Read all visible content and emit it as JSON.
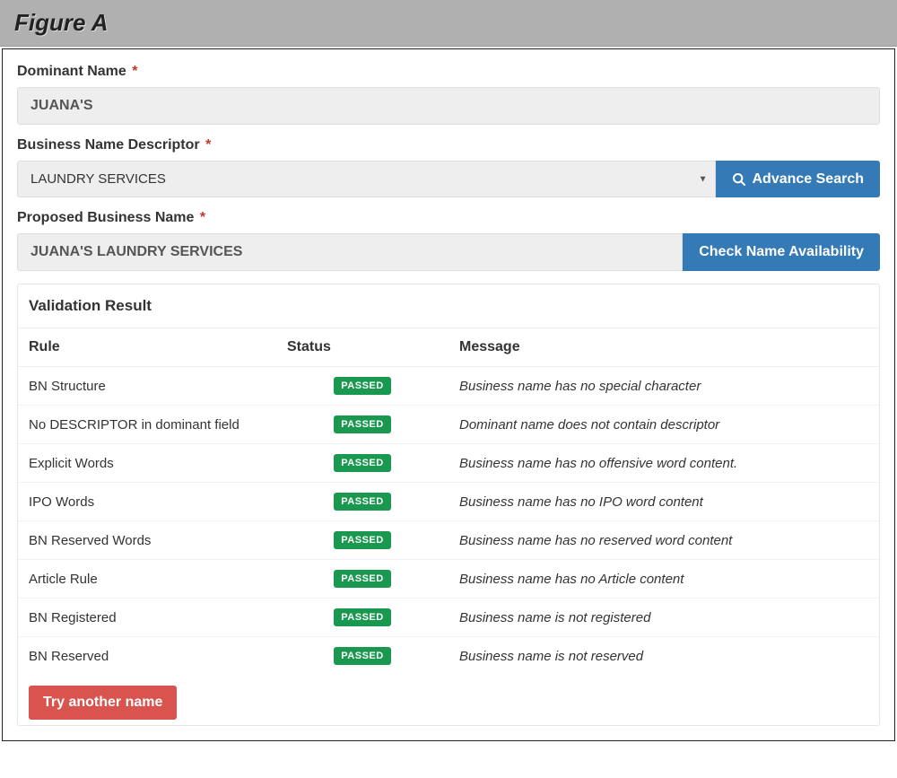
{
  "figure_title": "Figure A",
  "labels": {
    "dominant_name": "Dominant Name",
    "descriptor": "Business Name Descriptor",
    "proposed": "Proposed Business Name",
    "required_mark": "*"
  },
  "fields": {
    "dominant_value": "JUANA'S",
    "descriptor_value": "LAUNDRY SERVICES",
    "proposed_value": "JUANA'S LAUNDRY SERVICES"
  },
  "buttons": {
    "advance_search": "Advance Search",
    "check_availability": "Check Name Availability",
    "try_another": "Try another name"
  },
  "validation": {
    "title": "Validation Result",
    "columns": {
      "rule": "Rule",
      "status": "Status",
      "message": "Message"
    },
    "passed_label": "PASSED",
    "rows": [
      {
        "rule": "BN Structure",
        "status": "PASSED",
        "message": "Business name has no special character"
      },
      {
        "rule": "No DESCRIPTOR in dominant field",
        "status": "PASSED",
        "message": "Dominant name does not contain descriptor"
      },
      {
        "rule": "Explicit Words",
        "status": "PASSED",
        "message": "Business name has no offensive word content."
      },
      {
        "rule": "IPO Words",
        "status": "PASSED",
        "message": "Business name has no IPO word content"
      },
      {
        "rule": "BN Reserved Words",
        "status": "PASSED",
        "message": "Business name has no reserved word content"
      },
      {
        "rule": "Article Rule",
        "status": "PASSED",
        "message": "Business name has no Article content"
      },
      {
        "rule": "BN Registered",
        "status": "PASSED",
        "message": "Business name is not registered"
      },
      {
        "rule": "BN Reserved",
        "status": "PASSED",
        "message": "Business name is not reserved"
      }
    ]
  },
  "colors": {
    "blue": "#337ab7",
    "red": "#d9534f",
    "green": "#1a9850",
    "gray_bg": "#eee"
  }
}
